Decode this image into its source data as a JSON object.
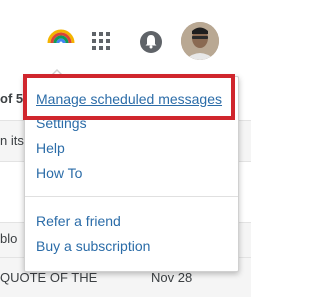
{
  "header": {
    "icons": [
      "rainbow-logo-icon",
      "apps-grid-icon",
      "notification-bell-icon",
      "user-avatar"
    ]
  },
  "background": {
    "rows": [
      {
        "text": "of 5",
        "date": ""
      },
      {
        "text": "n its",
        "date": ""
      },
      {
        "text": "blo",
        "date": ""
      },
      {
        "text": "QUOTE OF THE",
        "date": "Nov 28"
      }
    ]
  },
  "menu": {
    "items": [
      {
        "label": "Manage scheduled messages"
      },
      {
        "label": "Settings"
      },
      {
        "label": "Help"
      },
      {
        "label": "How To"
      },
      {
        "label": "Refer a friend"
      },
      {
        "label": "Buy a subscription"
      }
    ]
  },
  "colors": {
    "link": "#2b6ca8",
    "highlight": "#d0262d"
  }
}
